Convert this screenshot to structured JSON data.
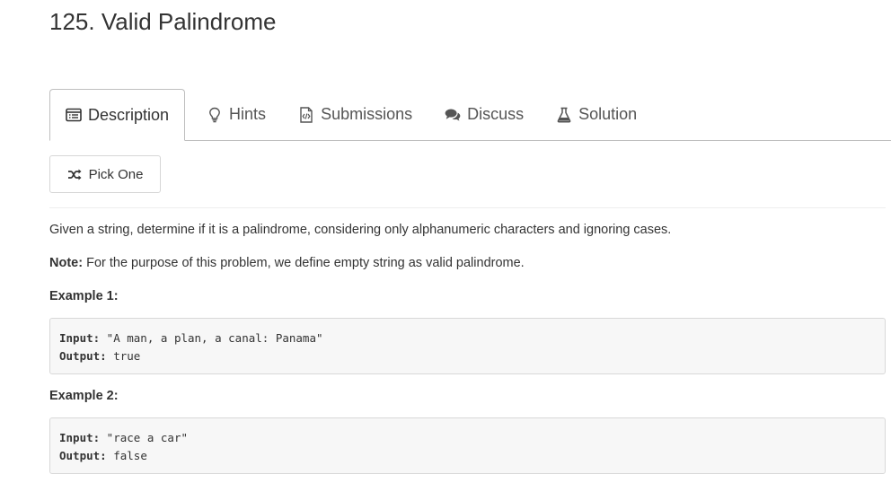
{
  "problem": {
    "title": "125. Valid Palindrome"
  },
  "tabs": [
    {
      "label": "Description",
      "icon": "description-icon",
      "active": true
    },
    {
      "label": "Hints",
      "icon": "lightbulb-icon",
      "active": false
    },
    {
      "label": "Submissions",
      "icon": "code-file-icon",
      "active": false
    },
    {
      "label": "Discuss",
      "icon": "comments-icon",
      "active": false
    },
    {
      "label": "Solution",
      "icon": "flask-icon",
      "active": false
    }
  ],
  "pick_button": {
    "label": "Pick One",
    "icon": "shuffle-icon"
  },
  "content": {
    "description": "Given a string, determine if it is a palindrome, considering only alphanumeric characters and ignoring cases.",
    "note_label": "Note:",
    "note_text": " For the purpose of this problem, we define empty string as valid palindrome."
  },
  "examples": [
    {
      "title": "Example 1:",
      "input_label": "Input:",
      "input_value": " \"A man, a plan, a canal: Panama\"",
      "output_label": "Output:",
      "output_value": " true"
    },
    {
      "title": "Example 2:",
      "input_label": "Input:",
      "input_value": " \"race a car\"",
      "output_label": "Output:",
      "output_value": " false"
    }
  ]
}
